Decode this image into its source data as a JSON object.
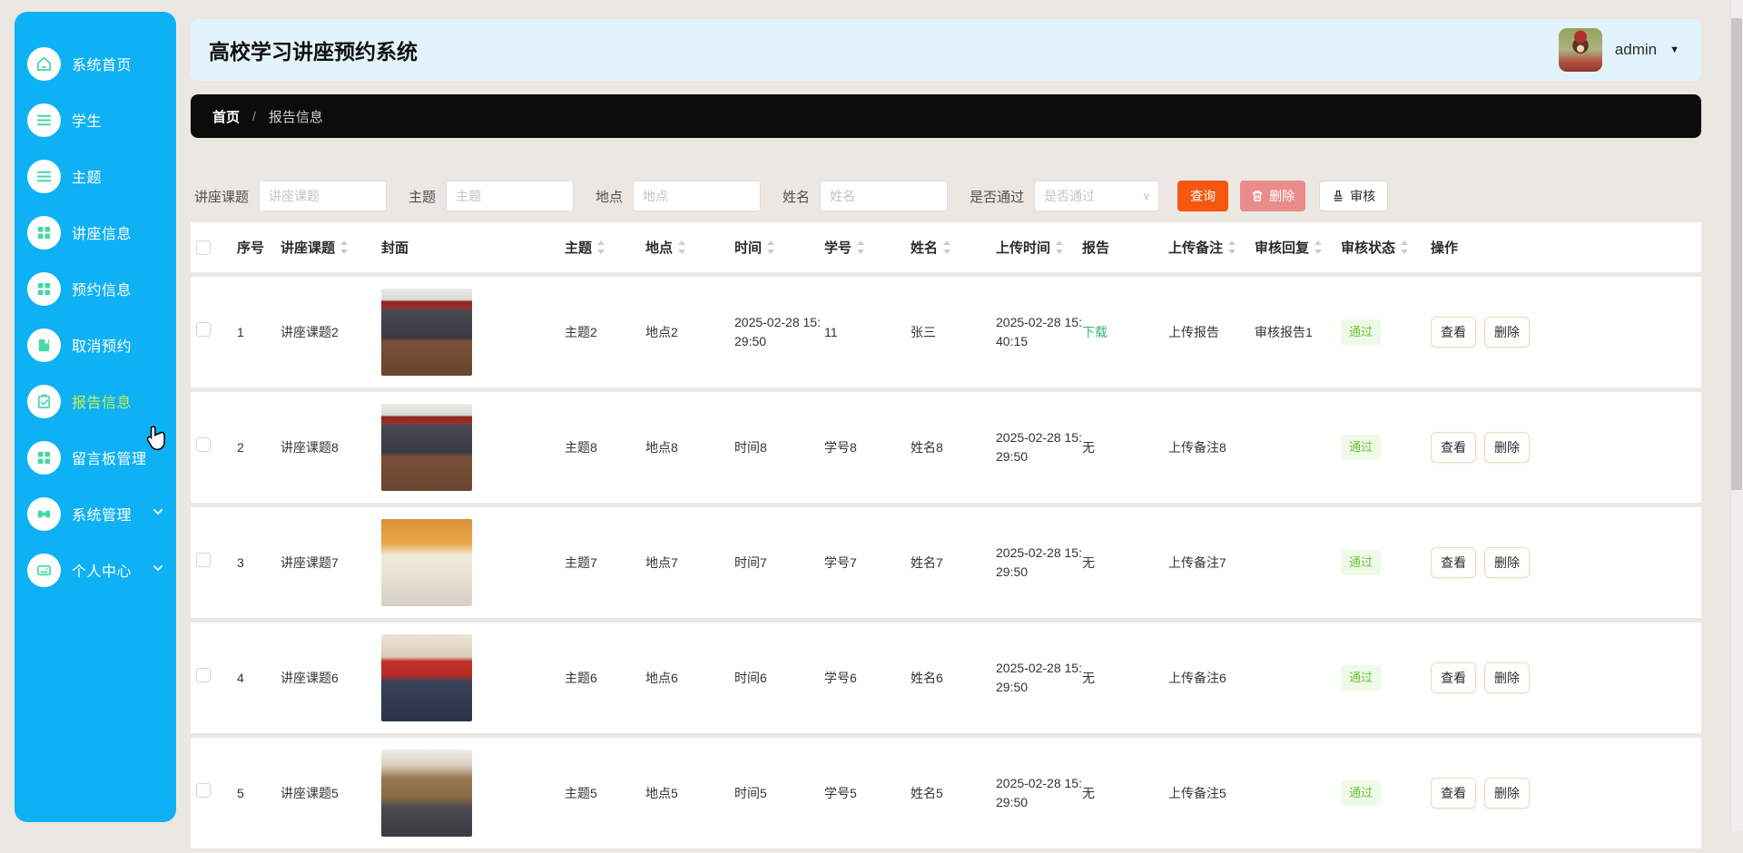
{
  "app": {
    "title": "高校学习讲座预约系统",
    "user_name": "admin"
  },
  "colors": {
    "sidebar_bg": "#0fb1f5",
    "sidebar_icon": "#46d7a5",
    "sidebar_active_text": "#c9f14c",
    "header_bg": "#e3f3fc",
    "breadcrumb_bg": "#0c0c0c",
    "page_bg": "#ebe7e3",
    "query_button": "#f5570f",
    "delete_button": "#ea8c8c",
    "pass_badge_text": "#6ec33c",
    "download_link": "#3ab377"
  },
  "sidebar": {
    "items": [
      {
        "label": "系统首页",
        "icon": "home",
        "active": false,
        "has_submenu": false
      },
      {
        "label": "学生",
        "icon": "list",
        "active": false,
        "has_submenu": false
      },
      {
        "label": "主题",
        "icon": "list-arrows",
        "active": false,
        "has_submenu": false
      },
      {
        "label": "讲座信息",
        "icon": "grid",
        "active": false,
        "has_submenu": false
      },
      {
        "label": "预约信息",
        "icon": "grid",
        "active": false,
        "has_submenu": false
      },
      {
        "label": "取消预约",
        "icon": "book",
        "active": false,
        "has_submenu": false
      },
      {
        "label": "报告信息",
        "icon": "clipboard-check",
        "active": true,
        "has_submenu": false
      },
      {
        "label": "留言板管理",
        "icon": "grid",
        "active": false,
        "has_submenu": false
      },
      {
        "label": "系统管理",
        "icon": "briefcase",
        "active": false,
        "has_submenu": true
      },
      {
        "label": "个人中心",
        "icon": "id-card",
        "active": false,
        "has_submenu": true
      }
    ]
  },
  "breadcrumb": {
    "home": "首页",
    "separator": "/",
    "current": "报告信息"
  },
  "filters": {
    "topic": {
      "label": "讲座课题",
      "placeholder": "讲座课题",
      "value": ""
    },
    "subject": {
      "label": "主题",
      "placeholder": "主题",
      "value": ""
    },
    "location": {
      "label": "地点",
      "placeholder": "地点",
      "value": ""
    },
    "name": {
      "label": "姓名",
      "placeholder": "姓名",
      "value": ""
    },
    "passed": {
      "label": "是否通过",
      "placeholder": "是否通过",
      "value": ""
    },
    "query_label": "查询",
    "delete_label": "删除",
    "audit_label": "审核"
  },
  "table": {
    "columns": [
      {
        "label": "序号",
        "sortable": false
      },
      {
        "label": "讲座课题",
        "sortable": true
      },
      {
        "label": "封面",
        "sortable": false
      },
      {
        "label": "主题",
        "sortable": true
      },
      {
        "label": "地点",
        "sortable": true
      },
      {
        "label": "时间",
        "sortable": true
      },
      {
        "label": "学号",
        "sortable": true
      },
      {
        "label": "姓名",
        "sortable": true
      },
      {
        "label": "上传时间",
        "sortable": true
      },
      {
        "label": "报告",
        "sortable": false
      },
      {
        "label": "上传备注",
        "sortable": true
      },
      {
        "label": "审核回复",
        "sortable": true
      },
      {
        "label": "审核状态",
        "sortable": true
      },
      {
        "label": "操作",
        "sortable": false
      }
    ],
    "actions": {
      "view": "查看",
      "delete": "删除"
    },
    "rows": [
      {
        "index": "1",
        "topic": "讲座课题2",
        "cover": "conference-room-photo",
        "subject": "主题2",
        "location": "地点2",
        "time": "2025-02-28 15:29:50",
        "student_id": "11",
        "name": "张三",
        "upload_time": "2025-02-28 15:40:15",
        "report": "下载",
        "upload_note": "上传报告",
        "audit_reply": "审核报告1",
        "audit_status": "通过"
      },
      {
        "index": "2",
        "topic": "讲座课题8",
        "cover": "conference-room-photo",
        "subject": "主题8",
        "location": "地点8",
        "time": "时间8",
        "student_id": "学号8",
        "name": "姓名8",
        "upload_time": "2025-02-28 15:29:50",
        "report": "无",
        "upload_note": "上传备注8",
        "audit_reply": "",
        "audit_status": "通过"
      },
      {
        "index": "3",
        "topic": "讲座课题7",
        "cover": "audience-hall-photo",
        "subject": "主题7",
        "location": "地点7",
        "time": "时间7",
        "student_id": "学号7",
        "name": "姓名7",
        "upload_time": "2025-02-28 15:29:50",
        "report": "无",
        "upload_note": "上传备注7",
        "audit_reply": "",
        "audit_status": "通过"
      },
      {
        "index": "4",
        "topic": "讲座课题6",
        "cover": "banquet-hall-photo",
        "subject": "主题6",
        "location": "地点6",
        "time": "时间6",
        "student_id": "学号6",
        "name": "姓名6",
        "upload_time": "2025-02-28 15:29:50",
        "report": "无",
        "upload_note": "上传备注6",
        "audit_reply": "",
        "audit_status": "通过"
      },
      {
        "index": "5",
        "topic": "讲座课题5",
        "cover": "lecture-hall-photo",
        "subject": "主题5",
        "location": "地点5",
        "time": "时间5",
        "student_id": "学号5",
        "name": "姓名5",
        "upload_time": "2025-02-28 15:29:50",
        "report": "无",
        "upload_note": "上传备注5",
        "audit_reply": "",
        "audit_status": "通过"
      }
    ]
  }
}
